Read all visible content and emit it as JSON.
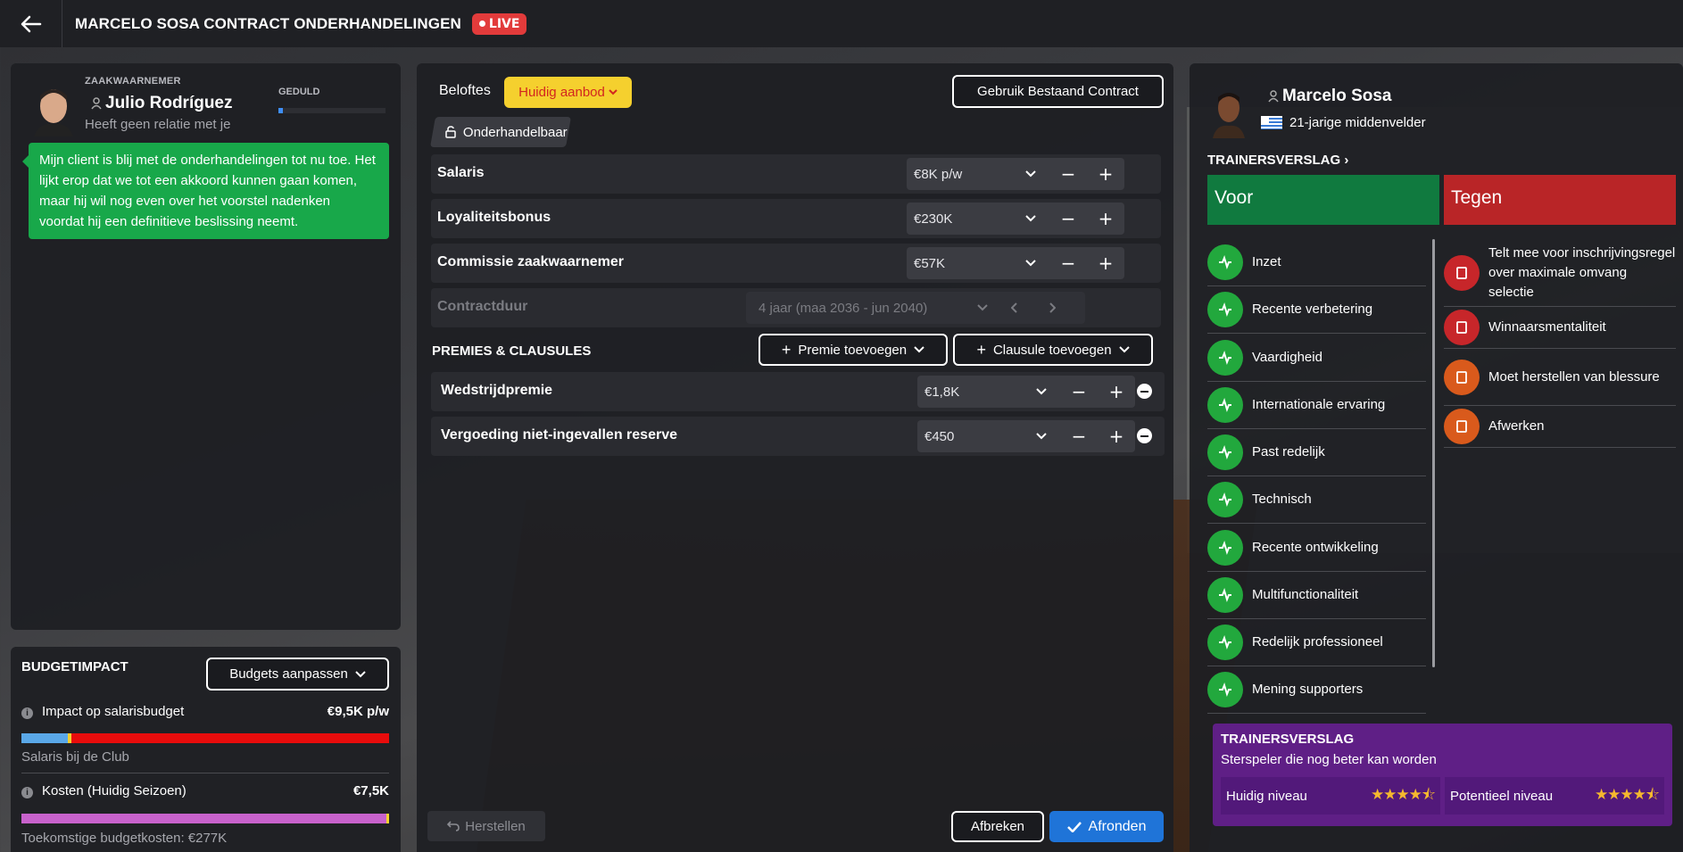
{
  "header": {
    "title": "MARCELO SOSA CONTRACT ONDERHANDELINGEN",
    "live": "LIVE"
  },
  "agent": {
    "label": "ZAAKWAARNEMER",
    "name": "Julio Rodríguez",
    "relation": "Heeft geen relatie met je",
    "patience_label": "GEDULD",
    "patience": 0.04,
    "message": "Mijn client is blij met de onderhandelingen tot nu toe. Het lijkt erop dat we tot een akkoord kunnen gaan komen, maar hij wil nog even over het voorstel nadenken voordat hij een definitieve beslissing neemt."
  },
  "budget": {
    "title": "BUDGETIMPACT",
    "adjust_label": "Budgets aanpassen",
    "salary_impact_label": "Impact op salarisbudget",
    "salary_impact_value": "€9,5K p/w",
    "salary_club_label": "Salaris bij de Club",
    "cost_label": "Kosten (Huidig Seizoen)",
    "cost_value": "€7,5K",
    "future_cost": "Toekomstige budgetkosten: €277K"
  },
  "offer": {
    "promise_label": "Beloftes",
    "current_offer": "Huidig aanbod",
    "use_existing": "Gebruik Bestaand Contract",
    "negotiable": "Onderhandelbaar",
    "fields": [
      {
        "label": "Salaris",
        "value": "€8K p/w"
      },
      {
        "label": "Loyaliteitsbonus",
        "value": "€230K"
      },
      {
        "label": "Commissie zaakwaarnemer",
        "value": "€57K"
      }
    ],
    "duration_label": "Contractduur",
    "duration_value": "4 jaar (maa 2036 - jun 2040)",
    "clauses_title": "PREMIES & CLAUSULES",
    "add_bonus": "Premie toevoegen",
    "add_clause": "Clausule toevoegen",
    "bonuses": [
      {
        "label": "Wedstrijdpremie",
        "value": "€1,8K"
      },
      {
        "label": "Vergoeding niet-ingevallen reserve",
        "value": "€450"
      }
    ],
    "restore": "Herstellen",
    "cancel": "Afbreken",
    "finish": "Afronden"
  },
  "player": {
    "name": "Marcelo Sosa",
    "desc": "21-jarige middenvelder",
    "report_title": "TRAINERSVERSLAG",
    "pro_label": "Voor",
    "con_label": "Tegen",
    "pros": [
      "Inzet",
      "Recente verbetering",
      "Vaardigheid",
      "Internationale ervaring",
      "Past redelijk",
      "Technisch",
      "Recente ontwikkeling",
      "Multifunctionaliteit",
      "Redelijk professioneel",
      "Mening supporters"
    ],
    "cons": [
      "Telt mee voor inschrijvingsregel over maximale omvang selectie",
      "Winnaarsmentaliteit",
      "Moet herstellen van blessure",
      "Afwerken"
    ],
    "summary_title": "TRAINERSVERSLAG",
    "summary_text": "Sterspeler die nog beter kan worden",
    "current_level_label": "Huidig niveau",
    "potential_level_label": "Potentieel niveau",
    "current_stars": 4.5,
    "potential_stars": 4.5
  }
}
